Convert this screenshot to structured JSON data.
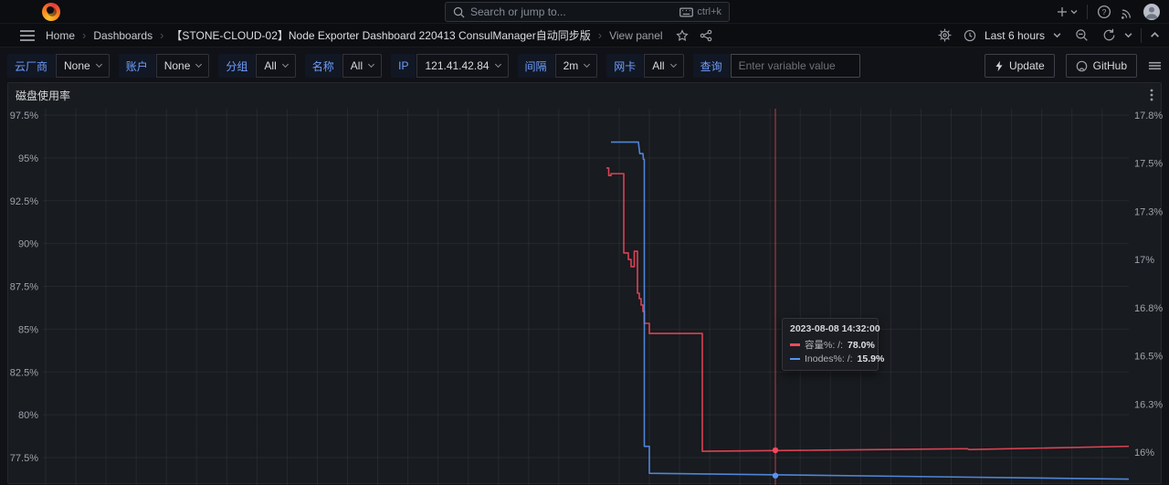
{
  "topbar": {
    "search": {
      "placeholder": "Search or jump to...",
      "shortcut": "ctrl+k"
    }
  },
  "breadcrumb": {
    "items": [
      {
        "label": "Home"
      },
      {
        "label": "Dashboards"
      },
      {
        "label": "【STONE-CLOUD-02】Node Exporter Dashboard 220413 ConsulManager自动同步版"
      },
      {
        "label": "View panel"
      }
    ],
    "time_range": "Last 6 hours"
  },
  "variables": [
    {
      "label": "云厂商",
      "value": "None"
    },
    {
      "label": "账户",
      "value": "None"
    },
    {
      "label": "分组",
      "value": "All"
    },
    {
      "label": "名称",
      "value": "All"
    },
    {
      "label": "IP",
      "value": "121.41.42.84"
    },
    {
      "label": "间隔",
      "value": "2m"
    },
    {
      "label": "网卡",
      "value": "All"
    },
    {
      "label": "查询",
      "value": "",
      "placeholder": "Enter variable value"
    }
  ],
  "toolbar": {
    "update_label": "Update",
    "github_label": "GitHub"
  },
  "panel": {
    "title": "磁盘使用率"
  },
  "chart_data": {
    "type": "line",
    "title": "磁盘使用率",
    "grid": true,
    "legend_position": "none",
    "x_axis": {
      "note": "time axis cropped out of view; hover time 2023-08-08 14:32:00, range last 6 hours"
    },
    "left_axis": {
      "tick_labels": [
        "97.5%",
        "95%",
        "92.5%",
        "90%",
        "87.5%",
        "85%",
        "82.5%",
        "80%",
        "77.5%"
      ],
      "tick_values": [
        97.5,
        95,
        92.5,
        90,
        87.5,
        85,
        82.5,
        80,
        77.5
      ]
    },
    "right_axis": {
      "tick_labels": [
        "17.8%",
        "17.5%",
        "17.3%",
        "17%",
        "16.8%",
        "16.5%",
        "16.3%",
        "16%"
      ],
      "tick_values": [
        17.75,
        17.5,
        17.25,
        17,
        16.75,
        16.5,
        16.25,
        16
      ]
    },
    "series": [
      {
        "name": "容量%: /:",
        "color": "#F2495C",
        "axis": "left",
        "points": [
          [
            663,
            94.41
          ],
          [
            665.5,
            94.41
          ],
          [
            665.5,
            93.97
          ],
          [
            668,
            93.97
          ],
          [
            668,
            94.08
          ],
          [
            682,
            94.08
          ],
          [
            682,
            89.45
          ],
          [
            687,
            89.45
          ],
          [
            687,
            89.07
          ],
          [
            690,
            89.07
          ],
          [
            690,
            88.65
          ],
          [
            693.5,
            88.65
          ],
          [
            693.5,
            89.55
          ],
          [
            697,
            89.55
          ],
          [
            697,
            87.1
          ],
          [
            699,
            87.1
          ],
          [
            699,
            86.78
          ],
          [
            701,
            86.78
          ],
          [
            701,
            86.41
          ],
          [
            703,
            86.41
          ],
          [
            703,
            86.03
          ],
          [
            704.5,
            86.03
          ],
          [
            704.5,
            85.34
          ],
          [
            710,
            85.34
          ],
          [
            710,
            84.75
          ],
          [
            768,
            84.75
          ],
          [
            768,
            77.87
          ],
          [
            1058,
            78.02
          ],
          [
            1060,
            77.97
          ],
          [
            1235,
            78.16
          ]
        ]
      },
      {
        "name": "Inodes%: /:",
        "color": "#5794F2",
        "axis": "right",
        "points": [
          [
            668,
            17.61
          ],
          [
            698,
            17.61
          ],
          [
            699.5,
            17.55
          ],
          [
            703,
            17.55
          ],
          [
            703.5,
            17.52
          ],
          [
            704.5,
            17.52
          ],
          [
            704.5,
            16.03
          ],
          [
            710,
            16.03
          ],
          [
            710,
            15.89
          ],
          [
            1235,
            15.86
          ]
        ]
      }
    ],
    "hover": {
      "x": 848,
      "values": [
        77.93,
        15.878
      ]
    },
    "tooltip": {
      "time": "2023-08-08 14:32:00",
      "rows": [
        {
          "name": "容量%: /:",
          "value": "78.0%"
        },
        {
          "name": "Inodes%: /:",
          "value": "15.9%"
        }
      ]
    }
  }
}
